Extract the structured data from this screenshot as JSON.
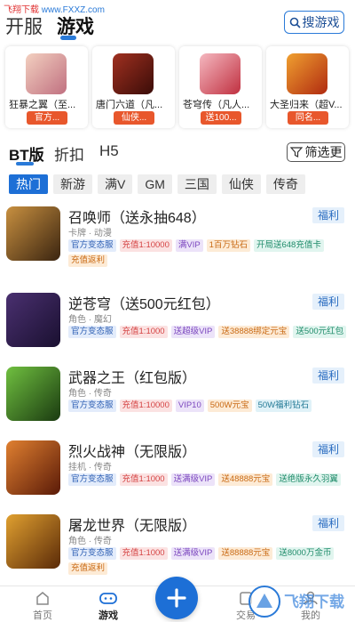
{
  "watermark": {
    "top_text": "飞翔下载",
    "top_site": "www.FXXZ.com"
  },
  "topbar": {
    "tab_open": "开服",
    "tab_game": "游戏",
    "search_label": "搜游戏"
  },
  "featured": [
    {
      "name": "狂暴之翼（至...",
      "tag": "官方...",
      "color": "#e8b0b0"
    },
    {
      "name": "唐门六道（凡...",
      "tag": "仙侠...",
      "color": "#7a1f16"
    },
    {
      "name": "苍穹传（凡人...",
      "tag": "送100...",
      "color": "#e06070"
    },
    {
      "name": "大圣归来（超V...",
      "tag": "同名...",
      "color": "#d0501a"
    }
  ],
  "subtabs": {
    "bt": "BT版",
    "discount": "折扣",
    "h5": "H5",
    "filter": "筛选更"
  },
  "categories": [
    "热门",
    "新游",
    "满V",
    "GM",
    "三国",
    "仙侠",
    "传奇"
  ],
  "games": [
    {
      "title": "召唤师（送永抽648）",
      "meta": "卡牌 · 动漫",
      "fuli": "福利",
      "tags": [
        {
          "t": "官方变态服",
          "c": "blue"
        },
        {
          "t": "充值1:10000",
          "c": "pink"
        },
        {
          "t": "满VIP",
          "c": "purple"
        },
        {
          "t": "1百万钻石",
          "c": "orange"
        },
        {
          "t": "开局送648充值卡",
          "c": "green"
        },
        {
          "t": "充值返利",
          "c": "orange"
        }
      ],
      "thumb": "#6b4a1c"
    },
    {
      "title": "逆苍穹（送500元红包）",
      "meta": "角色 · 魔幻",
      "fuli": "福利",
      "tags": [
        {
          "t": "官方变态服",
          "c": "blue"
        },
        {
          "t": "充值1:1000",
          "c": "pink"
        },
        {
          "t": "送超级VIP",
          "c": "purple"
        },
        {
          "t": "送38888绑定元宝",
          "c": "orange"
        },
        {
          "t": "送500元红包",
          "c": "green"
        }
      ],
      "thumb": "#3b2a4a"
    },
    {
      "title": "武器之王（红包版）",
      "meta": "角色 · 传奇",
      "fuli": "福利",
      "tags": [
        {
          "t": "官方变态服",
          "c": "blue"
        },
        {
          "t": "充值1:10000",
          "c": "pink"
        },
        {
          "t": "VIP10",
          "c": "purple"
        },
        {
          "t": "500W元宝",
          "c": "orange"
        },
        {
          "t": "50W福利钻石",
          "c": "cyan"
        }
      ],
      "thumb": "#2f6a2a"
    },
    {
      "title": "烈火战神（无限版）",
      "meta": "挂机 · 传奇",
      "fuli": "福利",
      "tags": [
        {
          "t": "官方变态服",
          "c": "blue"
        },
        {
          "t": "充值1:1000",
          "c": "pink"
        },
        {
          "t": "送满级VIP",
          "c": "purple"
        },
        {
          "t": "送48888元宝",
          "c": "orange"
        },
        {
          "t": "送绝版永久羽翼",
          "c": "green"
        }
      ],
      "thumb": "#7a2a10"
    },
    {
      "title": "屠龙世界（无限版）",
      "meta": "角色 · 传奇",
      "fuli": "福利",
      "tags": [
        {
          "t": "官方变态服",
          "c": "blue"
        },
        {
          "t": "充值1:1000",
          "c": "pink"
        },
        {
          "t": "送满级VIP",
          "c": "purple"
        },
        {
          "t": "送88888元宝",
          "c": "orange"
        },
        {
          "t": "送8000万金币",
          "c": "green"
        },
        {
          "t": "充值返利",
          "c": "orange"
        }
      ],
      "thumb": "#8a5a1a"
    }
  ],
  "bottombar": {
    "home": "首页",
    "game": "游戏",
    "trade": "交易",
    "mine": "我的"
  },
  "bottom_watermark": "飞翔下载"
}
